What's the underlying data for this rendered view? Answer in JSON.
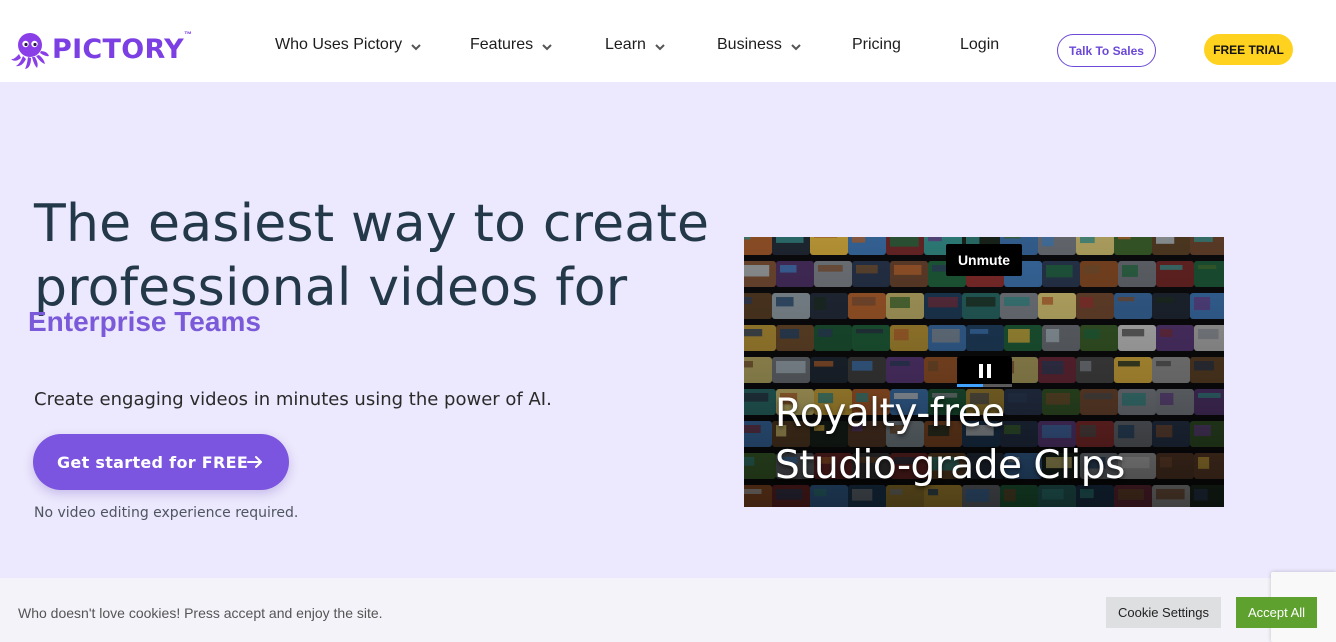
{
  "header": {
    "logo_text": "PICTORY",
    "logo_tm": "™",
    "nav": [
      {
        "label": "Who Uses Pictory",
        "has_dropdown": true
      },
      {
        "label": "Features",
        "has_dropdown": true
      },
      {
        "label": "Learn",
        "has_dropdown": true
      },
      {
        "label": "Business",
        "has_dropdown": true
      },
      {
        "label": "Pricing",
        "has_dropdown": false
      },
      {
        "label": "Login",
        "has_dropdown": false
      }
    ],
    "talk_to_sales": "Talk To Sales",
    "free_trial": "FREE TRIAL"
  },
  "hero": {
    "title_line1": "The easiest way to create",
    "title_line2": "professional videos for",
    "rotating_text": "Enterprise Teams",
    "subtitle": "Create engaging videos in minutes using the power of AI.",
    "cta_label": "Get started for FREE",
    "note": "No video editing experience required."
  },
  "video": {
    "unmute_label": "Unmute",
    "caption_line1": "Royalty-free",
    "caption_line2": "Studio-grade Clips",
    "progress": 0.48
  },
  "cookie_bar": {
    "text": "Who doesn't love cookies! Press accept and enjoy the site.",
    "settings_label": "Cookie Settings",
    "accept_label": "Accept All"
  },
  "colors": {
    "brand": "#7b3fe4",
    "hero_bg": "#ece8fd",
    "cta_bg": "#7b55e0",
    "trial_bg": "#ffd21f",
    "accept_bg": "#5ea12f",
    "rotating_text": "#7b5ad9"
  },
  "icons": {
    "logo": "octopus-logo-icon",
    "dropdown": "chevron-down-icon",
    "cta": "arrow-right-icon",
    "pause": "pause-icon"
  }
}
